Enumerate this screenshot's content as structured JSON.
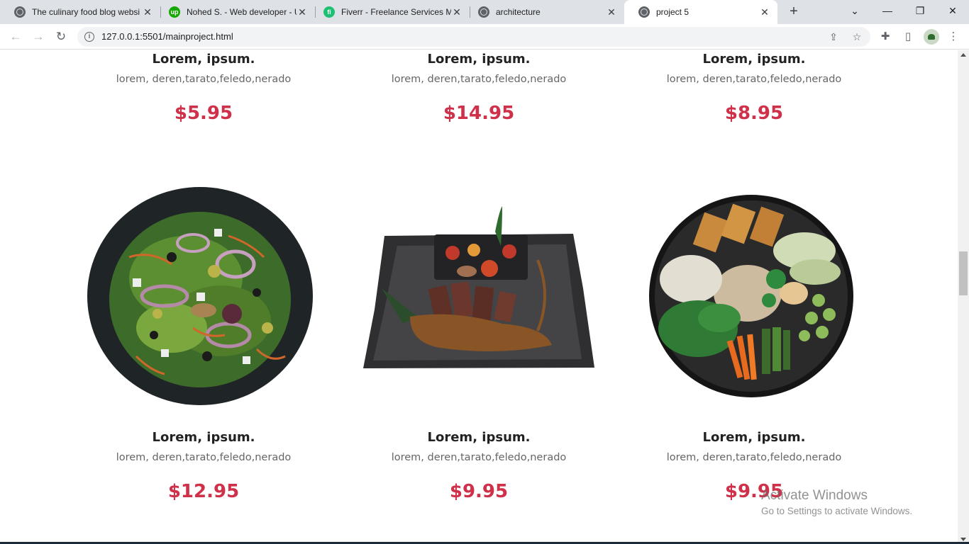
{
  "browser": {
    "tabs": [
      {
        "title": "The culinary food blog websi",
        "icon": "globe-icon"
      },
      {
        "title": "Nohed S. - Web developer - U",
        "icon": "upwork-icon"
      },
      {
        "title": "Fiverr - Freelance Services Ma",
        "icon": "fiverr-icon"
      },
      {
        "title": "architecture",
        "icon": "globe-icon"
      },
      {
        "title": "project 5",
        "icon": "globe-icon",
        "active": true
      }
    ],
    "new_tab_glyph": "+",
    "url": "127.0.0.1:5501/mainproject.html"
  },
  "menu": {
    "row1": [
      {
        "name": "Lorem, ipsum.",
        "desc": "lorem, deren,tarato,feledo,nerado",
        "price": "$5.95"
      },
      {
        "name": "Lorem, ipsum.",
        "desc": "lorem, deren,tarato,feledo,nerado",
        "price": "$14.95"
      },
      {
        "name": "Lorem, ipsum.",
        "desc": "lorem, deren,tarato,feledo,nerado",
        "price": "$8.95"
      }
    ],
    "row2": [
      {
        "name": "Lorem, ipsum.",
        "desc": "lorem, deren,tarato,feledo,nerado",
        "price": "$12.95",
        "image": "salad-plate"
      },
      {
        "name": "Lorem, ipsum.",
        "desc": "lorem, deren,tarato,feledo,nerado",
        "price": "$9.95",
        "image": "steak-plate"
      },
      {
        "name": "Lorem, ipsum.",
        "desc": "lorem, deren,tarato,feledo,nerado",
        "price": "$9.95",
        "image": "bowl-plate"
      }
    ]
  },
  "colors": {
    "price": "#d0314a",
    "name": "#222222",
    "desc": "#666666"
  },
  "watermark": {
    "line1": "Activate Windows",
    "line2": "Go to Settings to activate Windows."
  }
}
